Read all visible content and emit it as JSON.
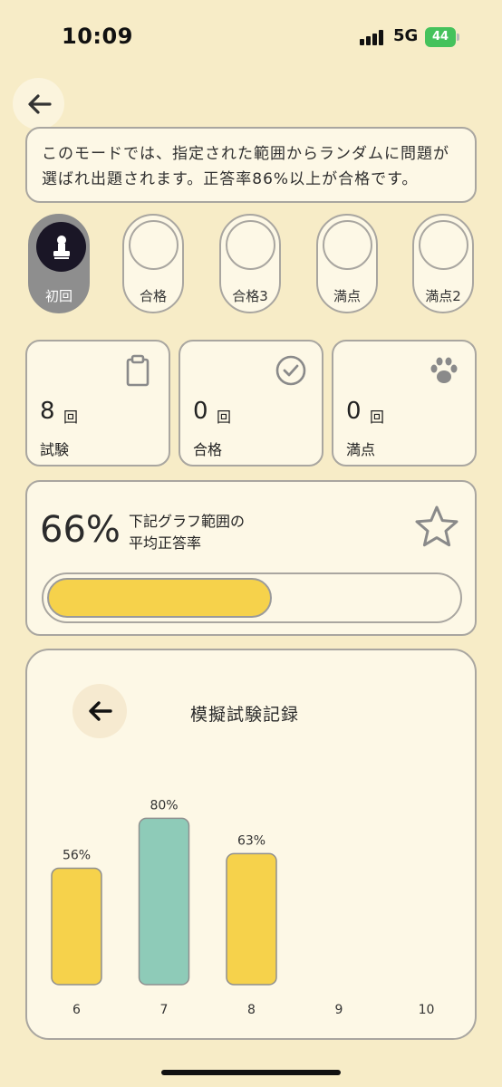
{
  "status": {
    "time": "10:09",
    "network": "5G",
    "battery": "44"
  },
  "description": "このモードでは、指定された範囲からランダムに問題が選ばれ出題されます。正答率86%以上が合格です。",
  "badges": [
    {
      "label": "初回",
      "active": true,
      "icon": "stamp-icon"
    },
    {
      "label": "合格",
      "active": false
    },
    {
      "label": "合格3",
      "active": false
    },
    {
      "label": "満点",
      "active": false
    },
    {
      "label": "満点2",
      "active": false
    }
  ],
  "stats": [
    {
      "value": "8",
      "unit": "回",
      "name": "試験",
      "icon": "clipboard-icon"
    },
    {
      "value": "0",
      "unit": "回",
      "name": "合格",
      "icon": "check-circle-icon"
    },
    {
      "value": "0",
      "unit": "回",
      "name": "満点",
      "icon": "paw-icon"
    }
  ],
  "average": {
    "percent_text": "66%",
    "label_line1": "下記グラフ範囲の",
    "label_line2": "平均正答率",
    "progress": 0.66,
    "icon": "star-icon"
  },
  "records": {
    "title": "模擬試験記録",
    "back_icon": "arrow-left-icon"
  },
  "chart_data": {
    "type": "bar",
    "categories": [
      "6",
      "7",
      "8",
      "9",
      "10"
    ],
    "values": [
      56,
      80,
      63,
      null,
      null
    ],
    "labels": [
      "56%",
      "80%",
      "63%",
      "",
      ""
    ],
    "colors": [
      "#f6d24b",
      "#8ecbb8",
      "#f6d24b",
      "",
      ""
    ],
    "ylim": [
      0,
      100
    ]
  },
  "colors": {
    "background": "#f7ecc7",
    "card": "#fdf8e6",
    "yellow": "#f6d24b",
    "teal": "#8ecbb8",
    "badge_active": "#8e8e8e"
  }
}
